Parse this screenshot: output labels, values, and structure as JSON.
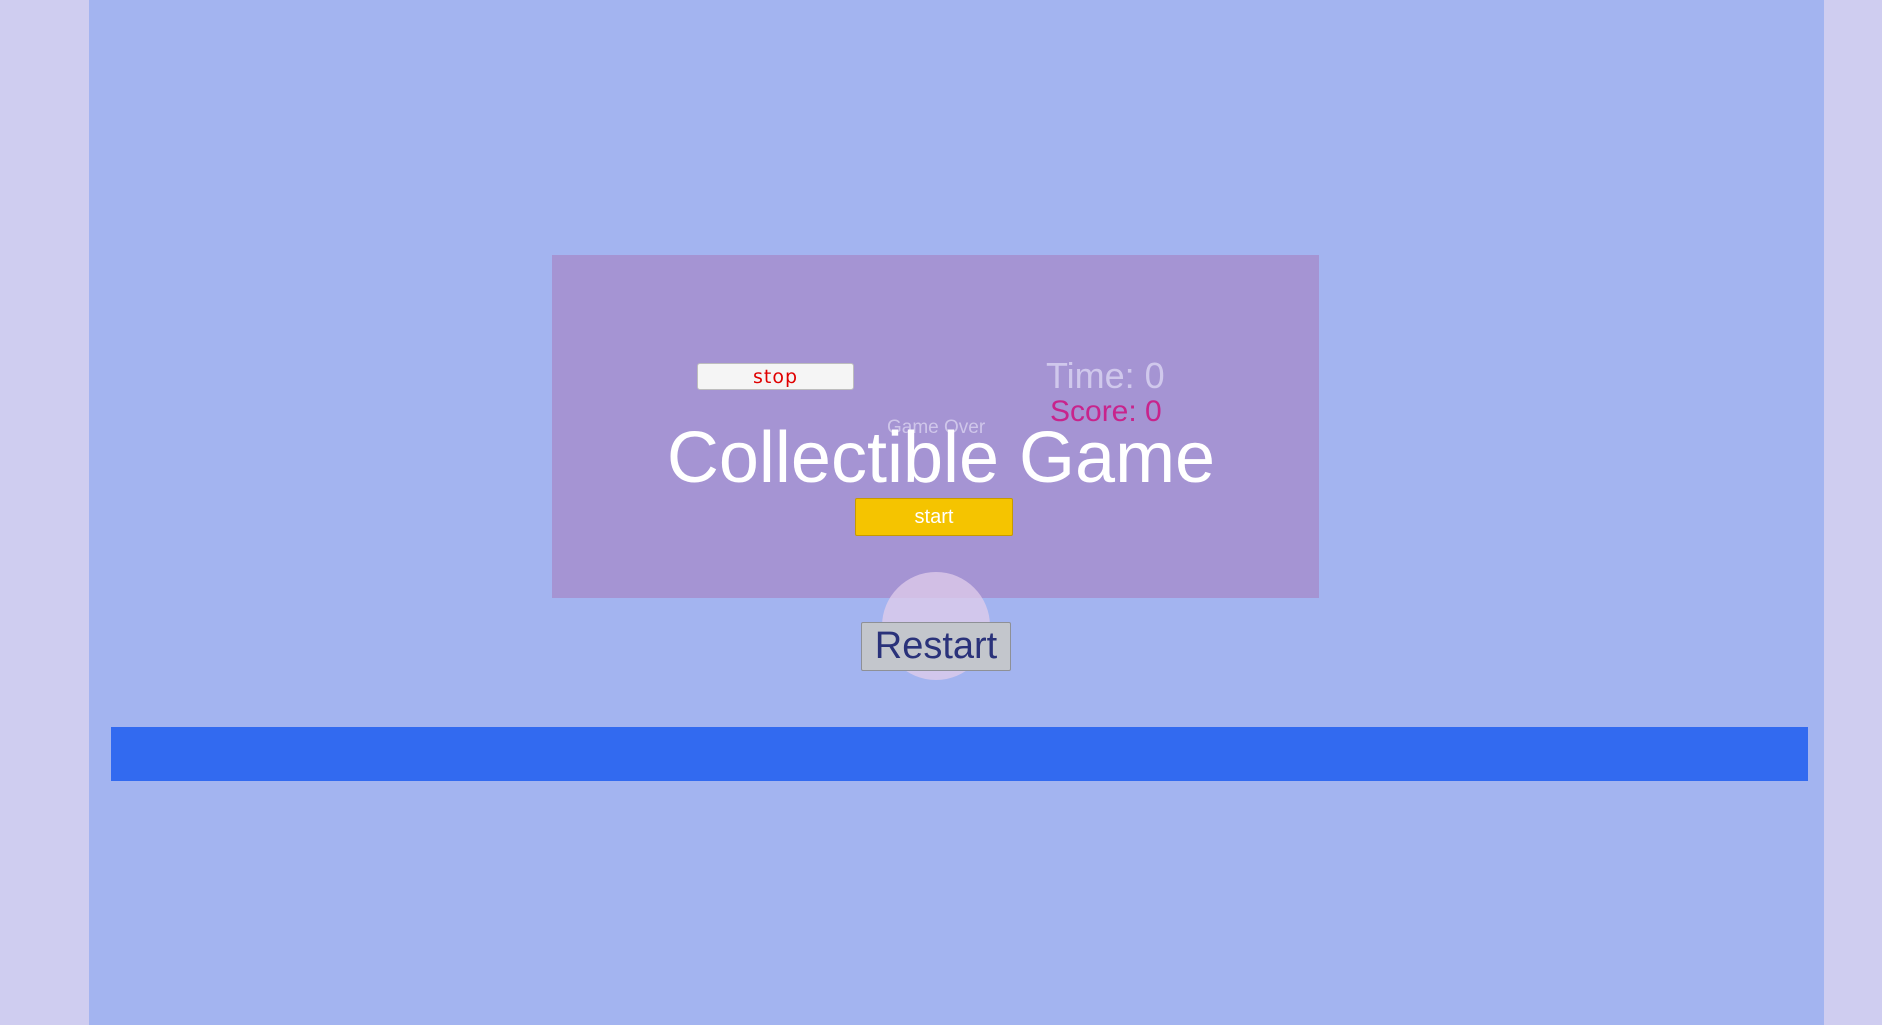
{
  "game": {
    "title": "Collectible Game",
    "time_label": "Time: 0",
    "score_label": "Score: 0",
    "game_over_label": "Game Over",
    "stop_label": "stop",
    "start_label": "start",
    "restart_label": "Restart"
  },
  "colors": {
    "outer_background": "#cfcdf0",
    "stage_background": "#a3b4f0",
    "panel_background": "#a594d3",
    "ground_bar": "#326af0",
    "start_button": "#f5c400",
    "stop_text": "#e00000",
    "score_text": "#c8248c",
    "collectible": "#e1cdeb"
  }
}
